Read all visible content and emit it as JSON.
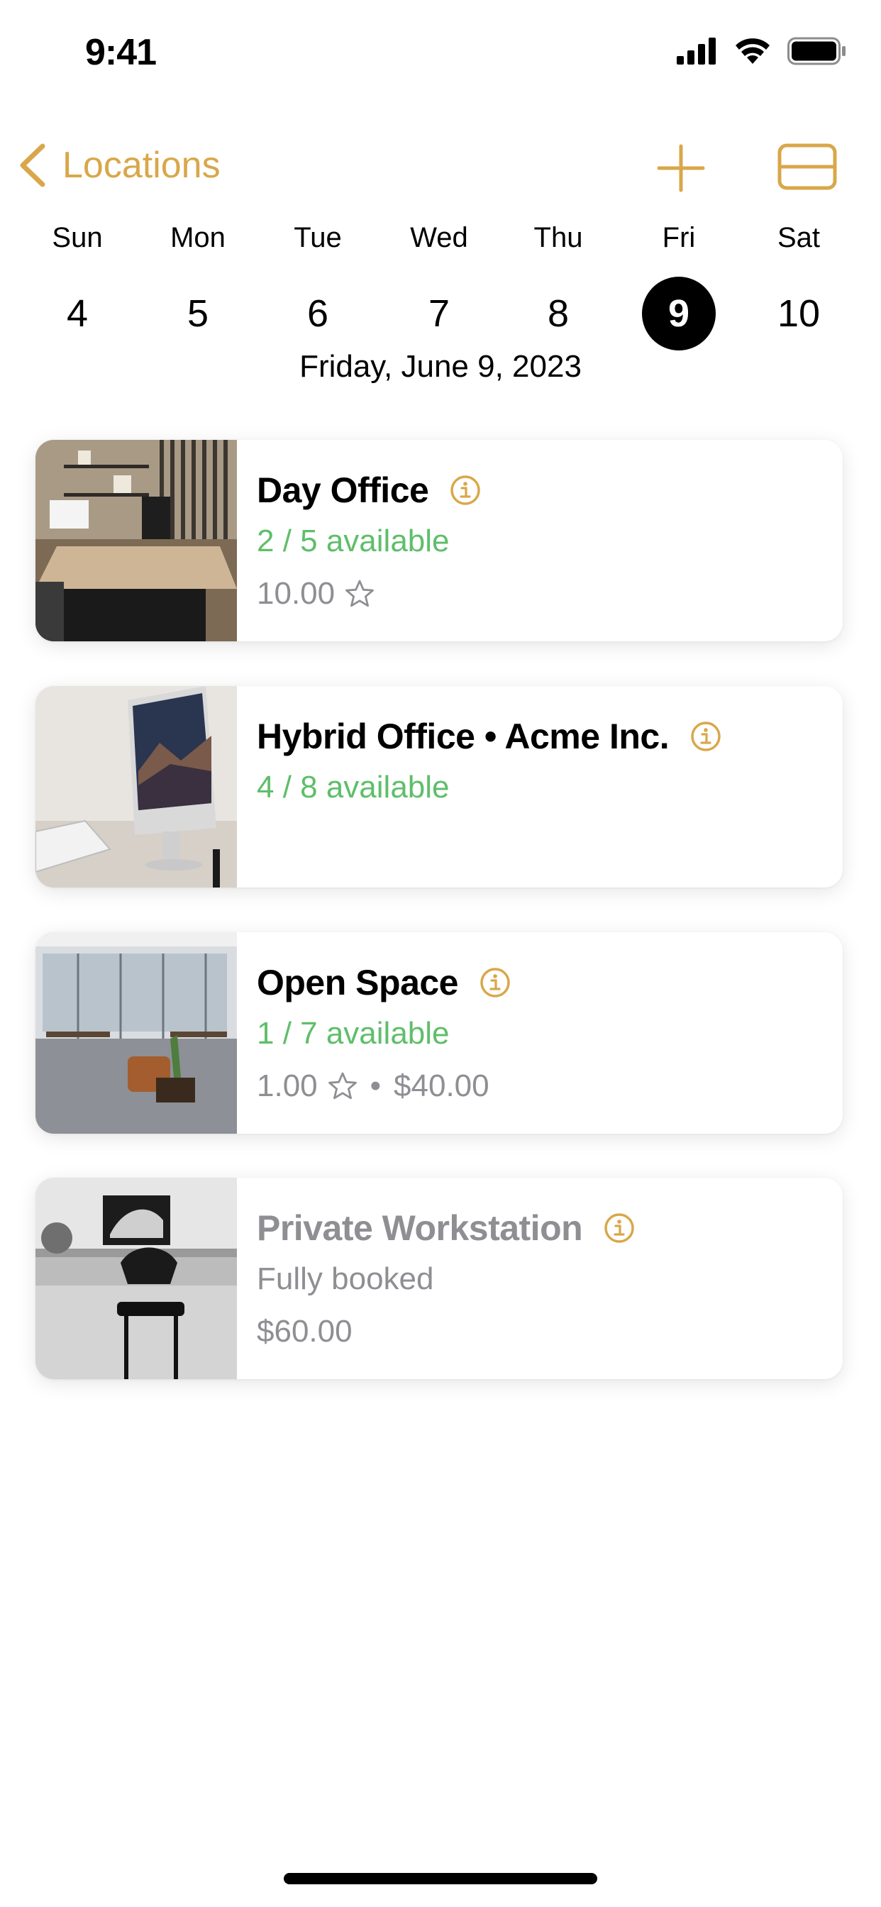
{
  "status_bar": {
    "time": "9:41"
  },
  "nav": {
    "back_label": "Locations"
  },
  "week": {
    "days": [
      {
        "dow": "Sun",
        "num": "4"
      },
      {
        "dow": "Mon",
        "num": "5"
      },
      {
        "dow": "Tue",
        "num": "6"
      },
      {
        "dow": "Wed",
        "num": "7"
      },
      {
        "dow": "Thu",
        "num": "8"
      },
      {
        "dow": "Fri",
        "num": "9",
        "selected": true
      },
      {
        "dow": "Sat",
        "num": "10"
      }
    ],
    "selected_date_label": "Friday, June 9, 2023"
  },
  "locations": [
    {
      "title": "Day Office",
      "availability": "2 / 5 available",
      "rating": "10.00",
      "price": ""
    },
    {
      "title": "Hybrid Office • Acme Inc.",
      "availability": "4 / 8 available",
      "rating": "",
      "price": ""
    },
    {
      "title": "Open Space",
      "availability": "1 / 7 available",
      "rating": "1.00",
      "separator": "•",
      "price": "$40.00"
    },
    {
      "title": "Private Workstation",
      "status": "Fully booked",
      "price": "$60.00"
    }
  ],
  "colors": {
    "accent": "#D9A74A",
    "available": "#5FBE6A",
    "muted": "#8E8E93",
    "selected_day_bg": "#000000"
  }
}
